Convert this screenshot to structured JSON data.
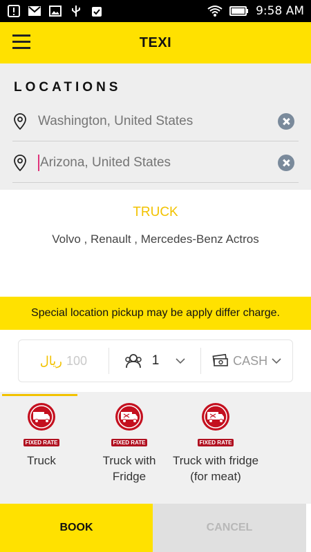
{
  "status_bar": {
    "time": "9:58 AM"
  },
  "app": {
    "title": "TEXI"
  },
  "locations": {
    "heading": "LOCATIONS",
    "pickup": {
      "value": "Washington, United States"
    },
    "dropoff": {
      "value": "Arizona, United States"
    }
  },
  "vehicle": {
    "type": "TRUCK",
    "brands": "Volvo , Renault , Mercedes-Benz Actros"
  },
  "notice": "Special location pickup may be apply differ charge.",
  "options": {
    "price_currency": "ريال",
    "price_value": "100",
    "passengers": "1",
    "payment": "CASH"
  },
  "tabs": [
    {
      "label": "Truck",
      "badge": "FIXED RATE"
    },
    {
      "label": "Truck with Fridge",
      "badge": "FIXED RATE"
    },
    {
      "label": "Truck with fridge (for meat)",
      "badge": "FIXED RATE"
    }
  ],
  "actions": {
    "book": "BOOK",
    "cancel": "CANCEL"
  },
  "colors": {
    "accent": "#FFE100",
    "accent_text": "#F2C200",
    "icon_red": "#C4101F"
  }
}
